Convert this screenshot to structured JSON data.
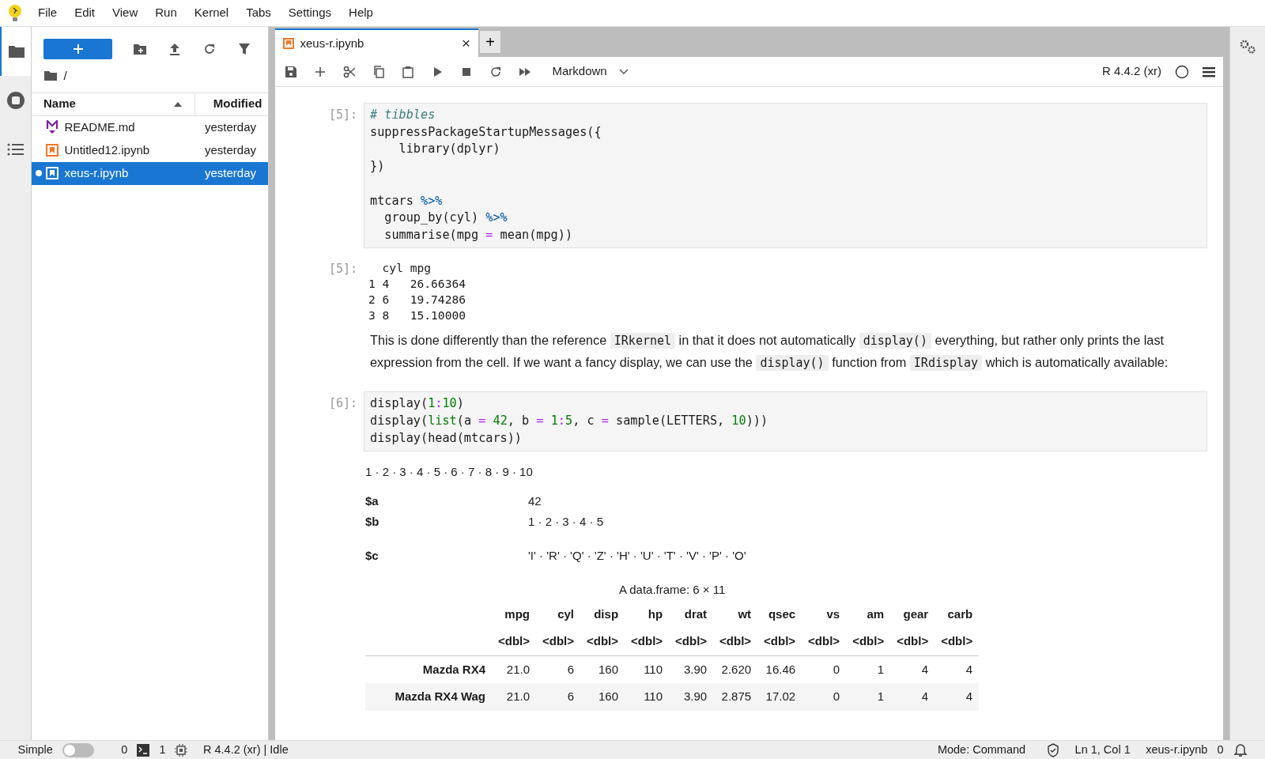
{
  "menu": [
    "File",
    "Edit",
    "View",
    "Run",
    "Kernel",
    "Tabs",
    "Settings",
    "Help"
  ],
  "file_browser": {
    "path": "/",
    "columns": [
      {
        "label": "Name",
        "sorted": true
      },
      {
        "label": "Modified",
        "sorted": false
      }
    ],
    "files": [
      {
        "name": "README.md",
        "modified": "yesterday",
        "kind": "markdown",
        "selected": false,
        "running": false
      },
      {
        "name": "Untitled12.ipynb",
        "modified": "yesterday",
        "kind": "notebook",
        "selected": false,
        "running": false
      },
      {
        "name": "xeus-r.ipynb",
        "modified": "yesterday",
        "kind": "notebook",
        "selected": true,
        "running": true
      }
    ]
  },
  "tab": {
    "title": "xeus-r.ipynb",
    "close": "×",
    "add": "+"
  },
  "toolbar": {
    "cell_type": "Markdown",
    "kernel": "R 4.4.2 (xr)"
  },
  "cells": [
    {
      "kind": "code",
      "prompt": "[5]:",
      "source": "# tibbles\nsuppressPackageStartupMessages({\n    library(dplyr)\n})\n\nmtcars %>%\n  group_by(cyl) %>%\n  summarise(mpg = mean(mpg))"
    },
    {
      "kind": "text_output",
      "prompt": "[5]:",
      "lines": [
        "  cyl mpg",
        "1 4   26.66364",
        "2 6   19.74286",
        "3 8   15.10000"
      ]
    },
    {
      "kind": "markdown",
      "parts": [
        {
          "text": "This is done differently than the reference ",
          "kind": "text"
        },
        {
          "text": "IRkernel",
          "kind": "code"
        },
        {
          "text": " in that it does not automatically ",
          "kind": "text"
        },
        {
          "text": "display()",
          "kind": "code"
        },
        {
          "text": " everything, but rather only prints the last expression from the cell. If we want a fancy display, we can use the ",
          "kind": "text"
        },
        {
          "text": "display()",
          "kind": "code"
        },
        {
          "text": " function from ",
          "kind": "text"
        },
        {
          "text": "IRdisplay",
          "kind": "code"
        },
        {
          "text": " which is automatically available:",
          "kind": "text"
        }
      ]
    },
    {
      "kind": "code",
      "prompt": "[6]:",
      "source": "display(1:10)\ndisplay(list(a = 42, b = 1:5, c = sample(LETTERS, 10)))\ndisplay(head(mtcars))"
    },
    {
      "kind": "vector_output",
      "text": "1 · 2 · 3 · 4 · 5 · 6 · 7 · 8 · 9 · 10"
    },
    {
      "kind": "list_output",
      "items": [
        {
          "name": "$a",
          "value": "42"
        },
        {
          "name": "$b",
          "value": "1 · 2 · 3 · 4 · 5"
        },
        {
          "name": "$c",
          "value": "'I' · 'R' · 'Q' · 'Z' · 'H' · 'U' · 'T' · 'V' · 'P' · 'O'"
        }
      ]
    },
    {
      "kind": "table_output",
      "caption": "A data.frame: 6 × 11",
      "columns": [
        "mpg",
        "cyl",
        "disp",
        "hp",
        "drat",
        "wt",
        "qsec",
        "vs",
        "am",
        "gear",
        "carb"
      ],
      "types": [
        "<dbl>",
        "<dbl>",
        "<dbl>",
        "<dbl>",
        "<dbl>",
        "<dbl>",
        "<dbl>",
        "<dbl>",
        "<dbl>",
        "<dbl>",
        "<dbl>"
      ],
      "rows": [
        {
          "name": "Mazda RX4",
          "values": [
            "21.0",
            "6",
            "160",
            "110",
            "3.90",
            "2.620",
            "16.46",
            "0",
            "1",
            "4",
            "4"
          ]
        },
        {
          "name": "Mazda RX4 Wag",
          "values": [
            "21.0",
            "6",
            "160",
            "110",
            "3.90",
            "2.875",
            "17.02",
            "0",
            "1",
            "4",
            "4"
          ]
        }
      ]
    }
  ],
  "status_bar": {
    "simple_label": "Simple",
    "simple_on": false,
    "terminals": "0",
    "kernels": "1",
    "kernel_status": "R 4.4.2 (xr) | Idle",
    "mode": "Mode: Command",
    "position": "Ln 1, Col 1",
    "file": "xeus-r.ipynb",
    "notifications": "0"
  }
}
